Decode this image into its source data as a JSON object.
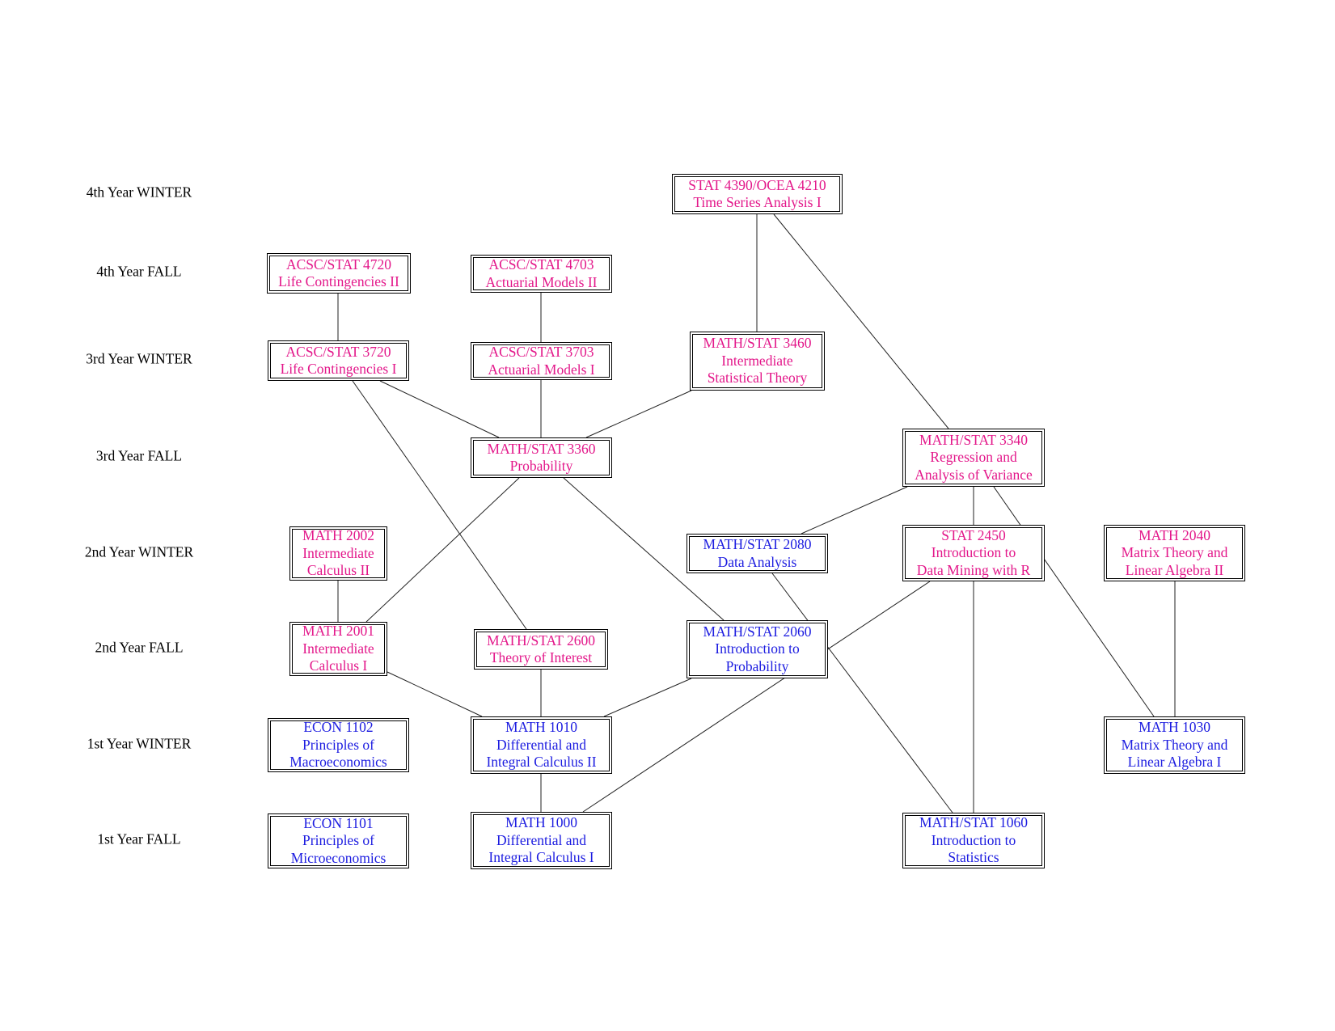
{
  "colors": {
    "upper": "#e3178a",
    "lower": "#1c1ce0",
    "edge": "#222222"
  },
  "years": [
    {
      "id": "y4w",
      "label": "4th Year WINTER"
    },
    {
      "id": "y4f",
      "label": "4th Year FALL"
    },
    {
      "id": "y3w",
      "label": "3rd Year WINTER"
    },
    {
      "id": "y3f",
      "label": "3rd Year FALL"
    },
    {
      "id": "y2w",
      "label": "2nd Year WINTER"
    },
    {
      "id": "y2f",
      "label": "2nd Year FALL"
    },
    {
      "id": "y1w",
      "label": "1st Year WINTER"
    },
    {
      "id": "y1f",
      "label": "1st Year FALL"
    }
  ],
  "courses": [
    {
      "id": "stat4390",
      "color": "upper",
      "lines": [
        "STAT 4390/OCEA 4210",
        "Time Series Analysis I"
      ]
    },
    {
      "id": "acsc4720",
      "color": "upper",
      "lines": [
        "ACSC/STAT 4720",
        "Life Contingencies II"
      ]
    },
    {
      "id": "acsc4703",
      "color": "upper",
      "lines": [
        "ACSC/STAT 4703",
        "Actuarial Models II"
      ]
    },
    {
      "id": "acsc3720",
      "color": "upper",
      "lines": [
        "ACSC/STAT 3720",
        "Life Contingencies I"
      ]
    },
    {
      "id": "acsc3703",
      "color": "upper",
      "lines": [
        "ACSC/STAT 3703",
        "Actuarial Models I"
      ]
    },
    {
      "id": "stat3460",
      "color": "upper",
      "lines": [
        "MATH/STAT 3460",
        "Intermediate",
        "Statistical Theory"
      ]
    },
    {
      "id": "stat3360",
      "color": "upper",
      "lines": [
        "MATH/STAT 3360",
        "Probability"
      ]
    },
    {
      "id": "stat3340",
      "color": "upper",
      "lines": [
        "MATH/STAT 3340",
        "Regression and",
        "Analysis of Variance"
      ]
    },
    {
      "id": "math2002",
      "color": "upper",
      "lines": [
        "MATH 2002",
        "Intermediate",
        "Calculus II"
      ]
    },
    {
      "id": "stat2080",
      "color": "lower",
      "lines": [
        "MATH/STAT 2080",
        "Data Analysis"
      ]
    },
    {
      "id": "stat2450",
      "color": "upper",
      "lines": [
        "STAT 2450",
        "Introduction to",
        "Data Mining with R"
      ]
    },
    {
      "id": "math2040",
      "color": "upper",
      "lines": [
        "MATH 2040",
        "Matrix Theory and",
        "Linear Algebra II"
      ]
    },
    {
      "id": "math2001",
      "color": "upper",
      "lines": [
        "MATH 2001",
        "Intermediate",
        "Calculus I"
      ]
    },
    {
      "id": "stat2600",
      "color": "upper",
      "lines": [
        "MATH/STAT 2600",
        "Theory of Interest"
      ]
    },
    {
      "id": "stat2060",
      "color": "lower",
      "lines": [
        "MATH/STAT 2060",
        "Introduction to",
        "Probability"
      ]
    },
    {
      "id": "econ1102",
      "color": "lower",
      "lines": [
        "ECON 1102",
        "Principles of",
        "Macroeconomics"
      ]
    },
    {
      "id": "math1010",
      "color": "lower",
      "lines": [
        "MATH 1010",
        "Differential and",
        "Integral Calculus II"
      ]
    },
    {
      "id": "math1030",
      "color": "lower",
      "lines": [
        "MATH 1030",
        "Matrix Theory and",
        "Linear Algebra I"
      ]
    },
    {
      "id": "econ1101",
      "color": "lower",
      "lines": [
        "ECON 1101",
        "Principles of",
        "Microeconomics"
      ]
    },
    {
      "id": "math1000",
      "color": "lower",
      "lines": [
        "MATH 1000",
        "Differential and",
        "Integral Calculus I"
      ]
    },
    {
      "id": "stat1060",
      "color": "lower",
      "lines": [
        "MATH/STAT 1060",
        "Introduction to",
        "Statistics"
      ]
    }
  ],
  "edges": [
    [
      "stat4390",
      "stat3460"
    ],
    [
      "stat4390",
      "stat3340"
    ],
    [
      "acsc4720",
      "acsc3720"
    ],
    [
      "acsc4703",
      "acsc3703"
    ],
    [
      "acsc3720",
      "stat3360"
    ],
    [
      "acsc3703",
      "stat3360"
    ],
    [
      "stat3460",
      "stat3360"
    ],
    [
      "acsc3720",
      "stat2600"
    ],
    [
      "stat3360",
      "math2001"
    ],
    [
      "stat3360",
      "stat2060"
    ],
    [
      "stat3340",
      "stat2080"
    ],
    [
      "stat3340",
      "stat2450"
    ],
    [
      "stat3340",
      "math1030"
    ],
    [
      "math2002",
      "math2001"
    ],
    [
      "stat2080",
      "stat1060"
    ],
    [
      "stat2450",
      "math1000"
    ],
    [
      "stat2450",
      "stat1060"
    ],
    [
      "math2040",
      "math1030"
    ],
    [
      "math2001",
      "math1010"
    ],
    [
      "stat2600",
      "math1010"
    ],
    [
      "stat2060",
      "math1010"
    ],
    [
      "math1010",
      "math1000"
    ]
  ]
}
